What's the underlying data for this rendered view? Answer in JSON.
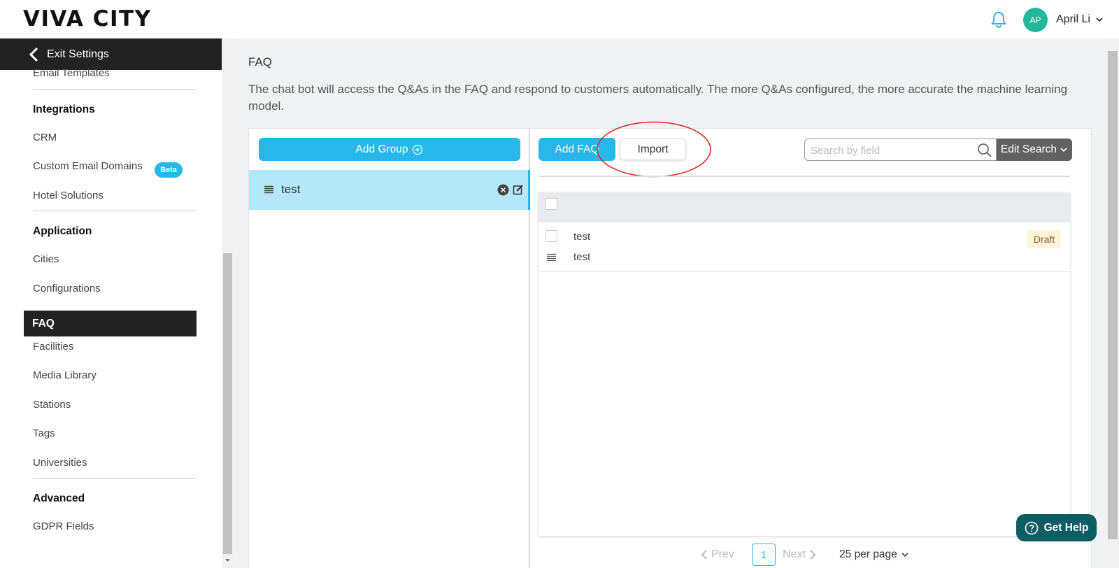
{
  "header": {
    "logo": "VIVA CITY",
    "user_initials": "AP",
    "user_name": "April Li"
  },
  "sidebar": {
    "exit_label": "Exit Settings",
    "top_item": "Email Templates",
    "sections": [
      {
        "title": "Integrations",
        "items": [
          "CRM",
          "Custom Email Domains",
          "Hotel Solutions"
        ]
      },
      {
        "title": "Application",
        "items": [
          "Cities",
          "Configurations",
          "FAQ",
          "Facilities",
          "Media Library",
          "Stations",
          "Tags",
          "Universities"
        ]
      },
      {
        "title": "Advanced",
        "items": [
          "GDPR Fields"
        ]
      }
    ],
    "beta_badge": "Beta",
    "active_item": "FAQ"
  },
  "main": {
    "title": "FAQ",
    "description": "The chat bot will access the Q&As in the FAQ and respond to customers automatically. The more Q&As configured, the more accurate the machine learning model."
  },
  "groups": {
    "add_label": "Add Group",
    "items": [
      {
        "name": "test"
      }
    ]
  },
  "faq": {
    "add_label": "Add FAQ",
    "import_label": "Import",
    "search_placeholder": "Search by field",
    "edit_search_label": "Edit Search",
    "rows": [
      {
        "question": "test",
        "answer": "test",
        "status": "Draft"
      }
    ]
  },
  "pagination": {
    "prev_label": "Prev",
    "current_page": "1",
    "next_label": "Next",
    "per_page_label": "25 per page"
  },
  "help": {
    "label": "Get Help"
  },
  "colors": {
    "accent": "#29b6e8",
    "dark": "#222222",
    "help": "#0c5e63",
    "avatar": "#1fb89b",
    "annotation": "#d9251c"
  }
}
